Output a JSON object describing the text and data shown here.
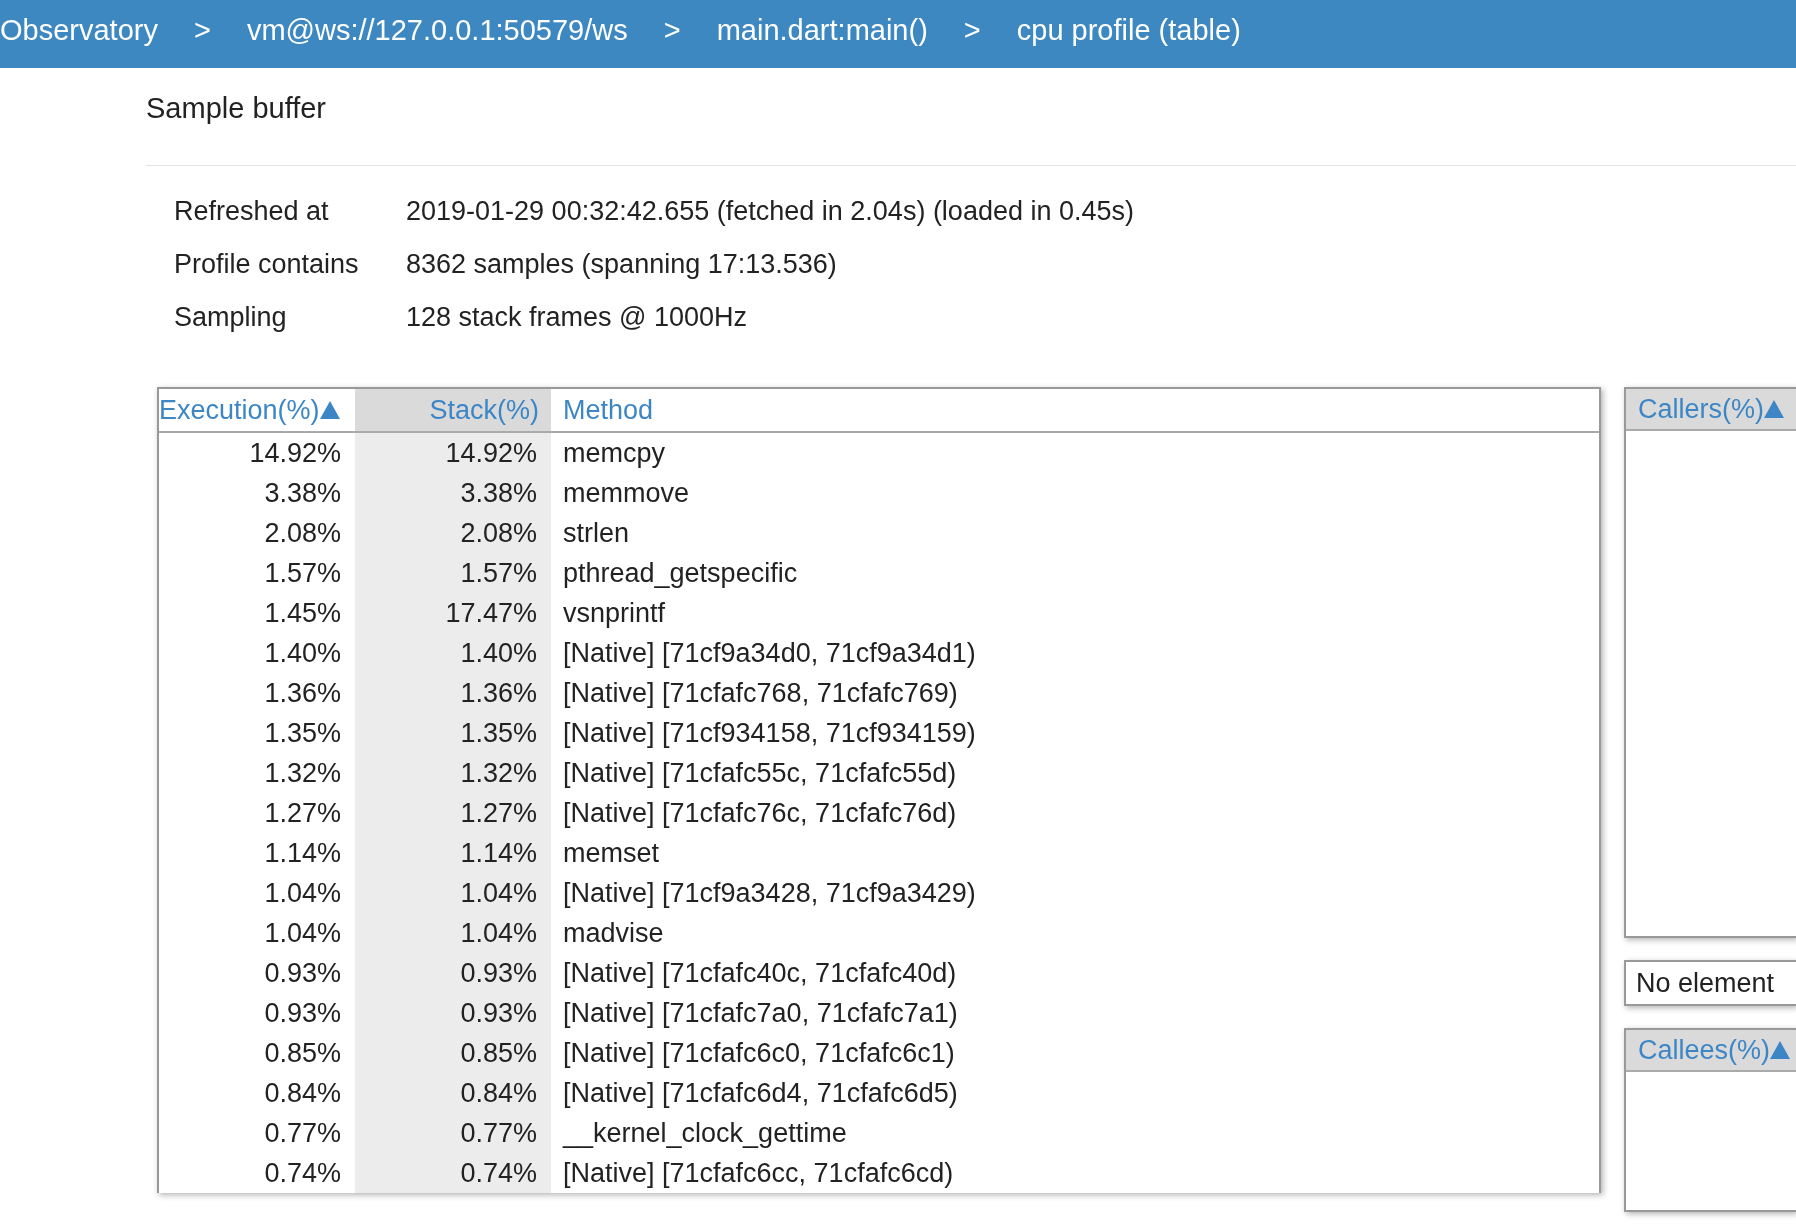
{
  "breadcrumbs": [
    {
      "label": "Observatory"
    },
    {
      "label": "vm@ws://127.0.0.1:50579/ws"
    },
    {
      "label": "main.dart:main()"
    },
    {
      "label": "cpu profile (table)"
    }
  ],
  "breadcrumb_separator": ">",
  "section_title": "Sample buffer",
  "info": [
    {
      "label": "Refreshed at",
      "value": "2019-01-29 00:32:42.655 (fetched in 2.04s) (loaded in 0.45s)"
    },
    {
      "label": "Profile contains",
      "value": "8362 samples (spanning 17:13.536)"
    },
    {
      "label": "Sampling",
      "value": "128 stack frames @ 1000Hz"
    }
  ],
  "table": {
    "columns": [
      {
        "label": "Execution(%)",
        "sorted": true
      },
      {
        "label": "Stack(%)",
        "sorted": false
      },
      {
        "label": "Method",
        "sorted": false
      }
    ],
    "rows": [
      [
        "14.92%",
        "14.92%",
        "memcpy"
      ],
      [
        "3.38%",
        "3.38%",
        "memmove"
      ],
      [
        "2.08%",
        "2.08%",
        "strlen"
      ],
      [
        "1.57%",
        "1.57%",
        "pthread_getspecific"
      ],
      [
        "1.45%",
        "17.47%",
        "vsnprintf"
      ],
      [
        "1.40%",
        "1.40%",
        "[Native] [71cf9a34d0, 71cf9a34d1)"
      ],
      [
        "1.36%",
        "1.36%",
        "[Native] [71cfafc768, 71cfafc769)"
      ],
      [
        "1.35%",
        "1.35%",
        "[Native] [71cf934158, 71cf934159)"
      ],
      [
        "1.32%",
        "1.32%",
        "[Native] [71cfafc55c, 71cfafc55d)"
      ],
      [
        "1.27%",
        "1.27%",
        "[Native] [71cfafc76c, 71cfafc76d)"
      ],
      [
        "1.14%",
        "1.14%",
        "memset"
      ],
      [
        "1.04%",
        "1.04%",
        "[Native] [71cf9a3428, 71cf9a3429)"
      ],
      [
        "1.04%",
        "1.04%",
        "madvise"
      ],
      [
        "0.93%",
        "0.93%",
        "[Native] [71cfafc40c, 71cfafc40d)"
      ],
      [
        "0.93%",
        "0.93%",
        "[Native] [71cfafc7a0, 71cfafc7a1)"
      ],
      [
        "0.85%",
        "0.85%",
        "[Native] [71cfafc6c0, 71cfafc6c1)"
      ],
      [
        "0.84%",
        "0.84%",
        "[Native] [71cfafc6d4, 71cfafc6d5)"
      ],
      [
        "0.77%",
        "0.77%",
        "__kernel_clock_gettime"
      ],
      [
        "0.74%",
        "0.74%",
        "[Native] [71cfafc6cc, 71cfafc6cd)"
      ]
    ]
  },
  "callers": {
    "label": "Callers(%)",
    "sorted": true
  },
  "selection_message": "No element",
  "callees": {
    "label": "Callees(%)",
    "sorted": true
  }
}
